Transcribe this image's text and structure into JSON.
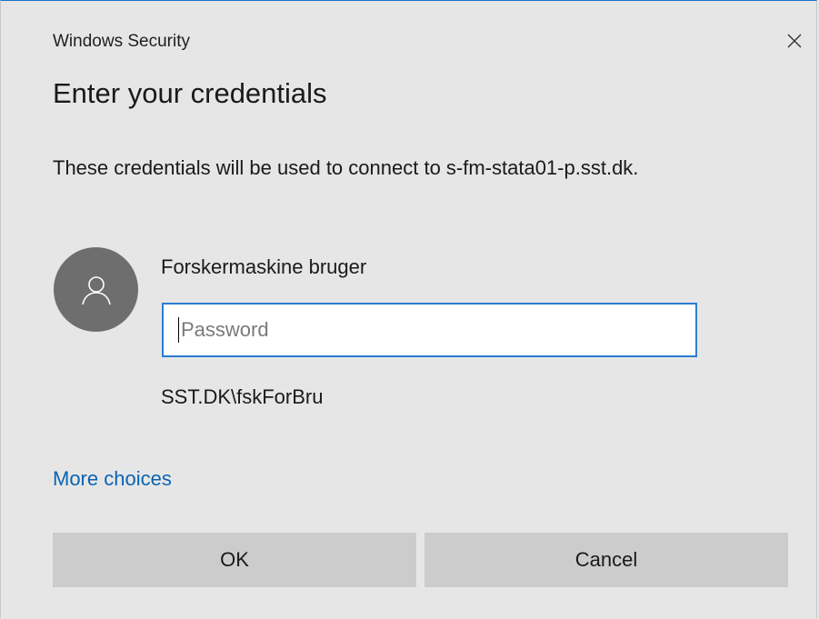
{
  "window": {
    "title": "Windows Security",
    "close_icon": "close-icon"
  },
  "dialog": {
    "heading": "Enter your credentials",
    "description": "These credentials will be used to connect to s-fm-stata01-p.sst.dk."
  },
  "account": {
    "avatar_icon": "user-icon",
    "display_name": "Forskermaskine bruger",
    "password": {
      "value": "",
      "placeholder": "Password"
    },
    "domain_user": "SST.DK\\fskForBru"
  },
  "links": {
    "more_choices": "More choices"
  },
  "buttons": {
    "ok_label": "OK",
    "cancel_label": "Cancel"
  },
  "colors": {
    "background": "#e6e6e6",
    "accent": "#2c7cd3",
    "link": "#0a64b4",
    "button": "#cccccc",
    "avatar": "#6e6e6e"
  }
}
